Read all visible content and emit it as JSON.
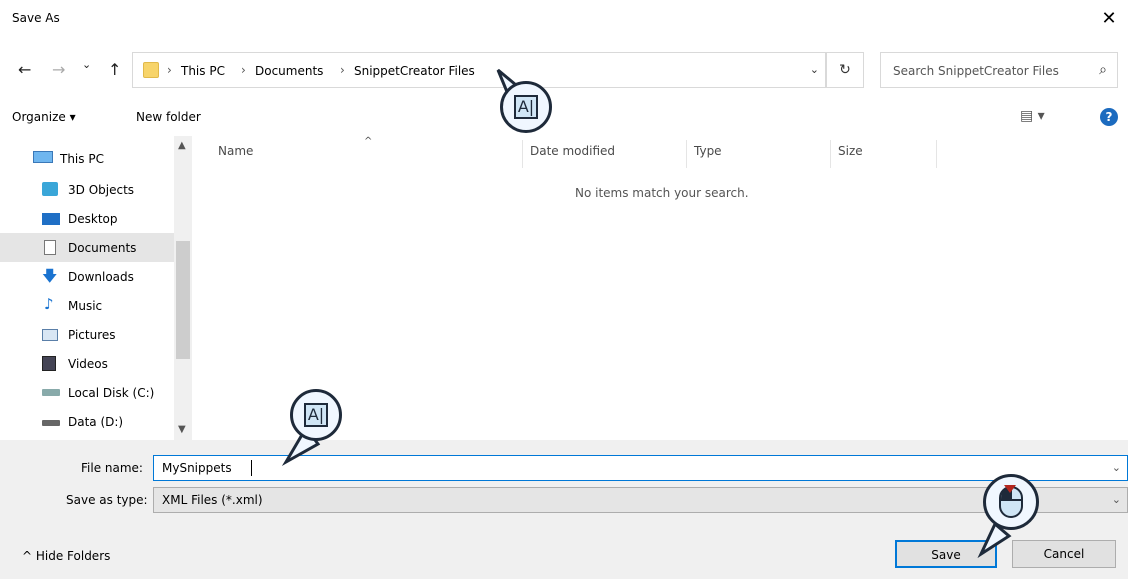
{
  "window": {
    "title": "Save As",
    "close_glyph": "✕"
  },
  "nav": {
    "back": "←",
    "forward": "→",
    "recent": "⌄",
    "up": "↑"
  },
  "address": {
    "crumbs": [
      "This PC",
      "Documents",
      "SnippetCreator Files"
    ],
    "separator": "›",
    "dropdown": "⌄",
    "refresh": "↻"
  },
  "search": {
    "placeholder": "Search SnippetCreator Files",
    "icon": "⌕"
  },
  "toolbar": {
    "organize": "Organize ▾",
    "new_folder": "New folder",
    "view": "▤ ▾",
    "help": "?"
  },
  "sidebar": {
    "items": [
      {
        "label": "This PC",
        "icon": "pc-icon"
      },
      {
        "label": "3D Objects",
        "icon": "cube-icon"
      },
      {
        "label": "Desktop",
        "icon": "desktop-icon"
      },
      {
        "label": "Documents",
        "icon": "documents-icon",
        "selected": true
      },
      {
        "label": "Downloads",
        "icon": "download-icon"
      },
      {
        "label": "Music",
        "icon": "music-icon"
      },
      {
        "label": "Pictures",
        "icon": "pictures-icon"
      },
      {
        "label": "Videos",
        "icon": "videos-icon"
      },
      {
        "label": "Local Disk (C:)",
        "icon": "disk-icon"
      },
      {
        "label": "Data (D:)",
        "icon": "drive-icon"
      }
    ]
  },
  "columns": {
    "name": "Name",
    "date": "Date modified",
    "type": "Type",
    "size": "Size"
  },
  "empty_message": "No items match your search.",
  "file_name": {
    "label": "File name:",
    "value": "MySnippets",
    "dropdown": "⌄"
  },
  "save_type": {
    "label": "Save as type:",
    "value": "XML Files (*.xml)",
    "dropdown": "⌄"
  },
  "hide_folders": "^  Hide Folders",
  "buttons": {
    "save": "Save",
    "cancel": "Cancel"
  },
  "callouts": {
    "text_icon_glyph": "A|"
  }
}
